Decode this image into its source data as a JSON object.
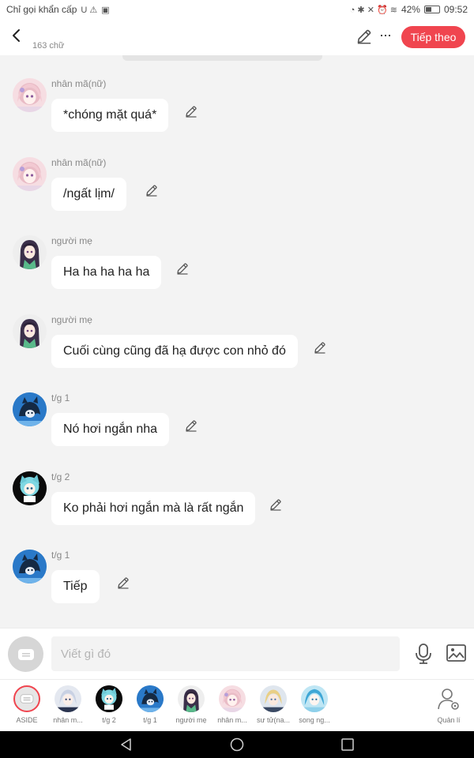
{
  "status_bar": {
    "left_text": "Chỉ gọi khẩn cấp",
    "left_glyphs": "U ⚠",
    "battery": "42%",
    "time": "09:52"
  },
  "header": {
    "word_count": "163 chữ",
    "next_label": "Tiếp theo"
  },
  "messages": [
    {
      "name": "nhân mã(nữ)",
      "text": "*chóng mặt quá*",
      "avatar": "pink-hair-girl"
    },
    {
      "name": "nhân mã(nữ)",
      "text": "/ngất lịm/",
      "avatar": "pink-hair-girl"
    },
    {
      "name": "người mẹ",
      "text": "Ha ha ha ha ha",
      "avatar": "dark-hair-woman"
    },
    {
      "name": "người mẹ",
      "text": "Cuối cùng cũng đã hạ được con nhỏ đó",
      "avatar": "dark-hair-woman"
    },
    {
      "name": "t/g 1",
      "text": "Nó hơi ngắn nha",
      "avatar": "blue-cat-character"
    },
    {
      "name": "t/g 2",
      "text": "Ko phải hơi ngắn mà là rất ngắn",
      "avatar": "teal-hair-chibi"
    },
    {
      "name": "t/g 1",
      "text": "Tiếp",
      "avatar": "blue-cat-character"
    }
  ],
  "composer": {
    "placeholder": "Viết gì đó"
  },
  "character_bar": {
    "items": [
      {
        "label": "ASIDE"
      },
      {
        "label": "nhân m..."
      },
      {
        "label": "t/g 2"
      },
      {
        "label": "t/g 1"
      },
      {
        "label": "người mẹ"
      },
      {
        "label": "nhân m..."
      },
      {
        "label": "sư tử(na..."
      },
      {
        "label": "song ng..."
      },
      {
        "label": "Quản lí"
      }
    ]
  },
  "colors": {
    "accent": "#f0454f",
    "background": "#f3f3f3",
    "bubble": "#ffffff"
  }
}
